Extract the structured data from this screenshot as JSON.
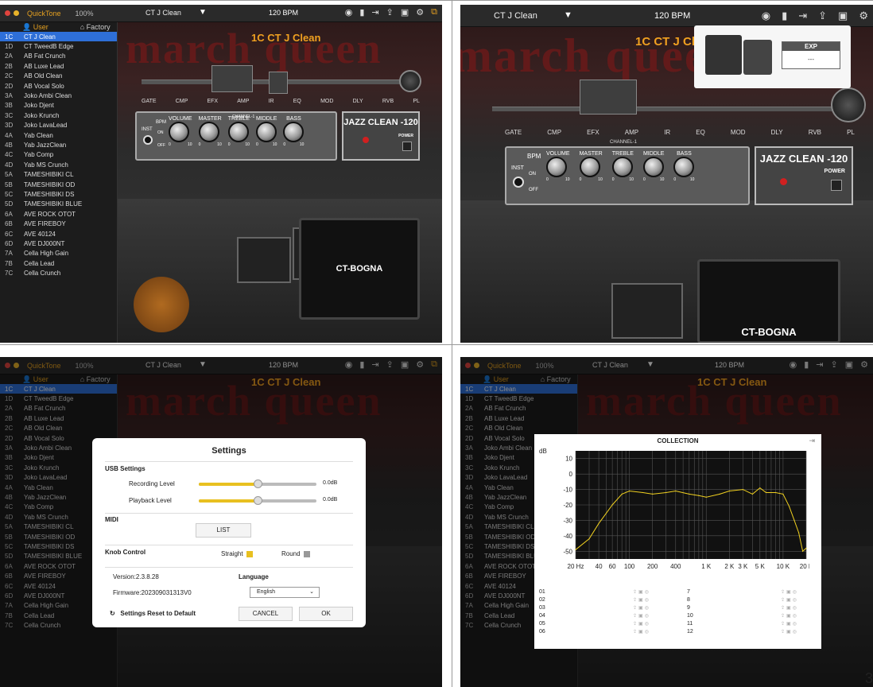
{
  "app": {
    "name": "QuickTone",
    "zoom": "100%"
  },
  "toolbar": {
    "preset": "CT J Clean",
    "bpm": "120",
    "bpm_unit": "BPM"
  },
  "sidebar": {
    "tab_user": "User",
    "tab_factory": "Factory",
    "presets": [
      {
        "num": "1C",
        "name": "CT J Clean"
      },
      {
        "num": "1D",
        "name": "CT TweedB Edge"
      },
      {
        "num": "2A",
        "name": "AB Fat Crunch"
      },
      {
        "num": "2B",
        "name": "AB Luxe Lead"
      },
      {
        "num": "2C",
        "name": "AB Old Clean"
      },
      {
        "num": "2D",
        "name": "AB Vocal Solo"
      },
      {
        "num": "3A",
        "name": "Joko Ambi Clean"
      },
      {
        "num": "3B",
        "name": "Joko Djent"
      },
      {
        "num": "3C",
        "name": "Joko Krunch"
      },
      {
        "num": "3D",
        "name": "Joko LavaLead"
      },
      {
        "num": "4A",
        "name": "Yab Clean"
      },
      {
        "num": "4B",
        "name": "Yab JazzClean"
      },
      {
        "num": "4C",
        "name": "Yab Comp"
      },
      {
        "num": "4D",
        "name": "Yab MS Crunch"
      },
      {
        "num": "5A",
        "name": "TAMESHIBIKI CL"
      },
      {
        "num": "5B",
        "name": "TAMESHIBIKI OD"
      },
      {
        "num": "5C",
        "name": "TAMESHIBIKI DS"
      },
      {
        "num": "5D",
        "name": "TAMESHIBIKI BLUE"
      },
      {
        "num": "6A",
        "name": "AVE ROCK OTOT"
      },
      {
        "num": "6B",
        "name": "AVE FIREBOY"
      },
      {
        "num": "6C",
        "name": "AVE 40124"
      },
      {
        "num": "6D",
        "name": "AVE DJ000NT"
      },
      {
        "num": "7A",
        "name": "Cella High Gain"
      },
      {
        "num": "7B",
        "name": "Cella Lead"
      },
      {
        "num": "7C",
        "name": "Cella Crunch"
      }
    ]
  },
  "stage": {
    "brand": "march queen",
    "preset_title": "1C CT J Clean",
    "chain": [
      "GATE",
      "CMP",
      "EFX",
      "AMP",
      "IR",
      "EQ",
      "MOD",
      "DLY",
      "RVB",
      "PL"
    ],
    "amp": {
      "channel": "CHANNEL-1",
      "inst": "INST",
      "bpm_switch": "BPM",
      "on": "ON",
      "off": "OFF",
      "knobs": [
        "VOLUME",
        "MASTER",
        "TREBLE",
        "MIDDLE",
        "BASS"
      ],
      "scale_min": "0",
      "scale_max": "10",
      "model": "JAZZ CLEAN -120",
      "power": "POWER"
    },
    "cabinet": "CT-BOGNA"
  },
  "exp_popup": {
    "label": "EXP",
    "value": "---"
  },
  "settings": {
    "title": "Settings",
    "usb": "USB Settings",
    "recording_level": "Recording Level",
    "recording_value": "0.0dB",
    "recording_fraction": 0.5,
    "playback_level": "Playback Level",
    "playback_value": "0.0dB",
    "playback_fraction": 0.5,
    "midi": "MIDI",
    "list": "LIST",
    "knob_control": "Knob Control",
    "straight": "Straight",
    "round": "Round",
    "version": "Version:2.3.8.28",
    "firmware": "Firmware:202309031313V0",
    "language": "Language",
    "language_value": "English",
    "reset": "Settings Reset to Default",
    "cancel": "CANCEL",
    "ok": "OK"
  },
  "collection": {
    "title": "COLLECTION",
    "ylabel": "dB",
    "slots_left": [
      "01",
      "02",
      "03",
      "04",
      "05",
      "06"
    ],
    "slots_right": [
      "7",
      "8",
      "9",
      "10",
      "11",
      "12"
    ]
  },
  "chart_data": {
    "type": "line",
    "title": "",
    "xlabel": "",
    "ylabel": "dB",
    "x_scale": "log",
    "x_ticks": [
      "20 Hz",
      "40",
      "60",
      "100",
      "200",
      "400",
      "1 K",
      "2 K",
      "3 K",
      "5 K",
      "10 K",
      "20 K"
    ],
    "x_tick_values": [
      20,
      40,
      60,
      100,
      200,
      400,
      1000,
      2000,
      3000,
      5000,
      10000,
      20000
    ],
    "y_ticks": [
      "10",
      "0",
      "-10",
      "-20",
      "-30",
      "-40",
      "-50"
    ],
    "ylim": [
      -55,
      15
    ],
    "xlim": [
      20,
      20000
    ],
    "series": [
      {
        "values_x": [
          20,
          30,
          40,
          60,
          80,
          100,
          150,
          200,
          300,
          400,
          600,
          800,
          1000,
          1500,
          2000,
          3000,
          4000,
          5000,
          6000,
          8000,
          10000,
          12000,
          14000,
          16000,
          18000,
          20000
        ],
        "values_y": [
          -49,
          -42,
          -32,
          -20,
          -13,
          -11,
          -12,
          -13,
          -12,
          -11,
          -13,
          -14,
          -15,
          -13,
          -11,
          -10,
          -13,
          -9,
          -12,
          -12,
          -13,
          -21,
          -30,
          -38,
          -50,
          -48
        ]
      }
    ],
    "color": "#f0d020"
  }
}
